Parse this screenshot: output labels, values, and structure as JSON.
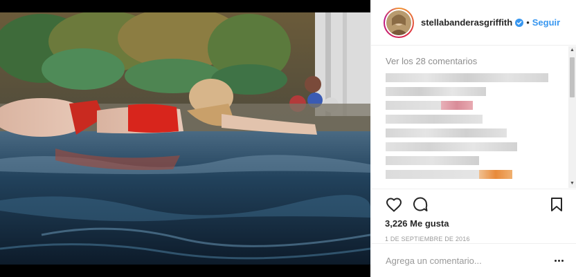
{
  "post": {
    "username": "stellabanderasgriffith",
    "verified": true,
    "separator": "•",
    "follow_label": "Seguir",
    "view_comments": "Ver los 28 comentarios",
    "likes": "3,226 Me gusta",
    "date": "1 DE SEPTIEMBRE DE 2016",
    "comment_placeholder": "Agrega un comentario..."
  },
  "icons": {
    "like": "heart-icon",
    "comment": "speech-bubble-icon",
    "save": "bookmark-icon",
    "more": "more-options-icon",
    "verified": "verified-badge-icon"
  },
  "colors": {
    "link": "#3897f0",
    "verified": "#3897f0",
    "muted": "#8e8e8e"
  }
}
